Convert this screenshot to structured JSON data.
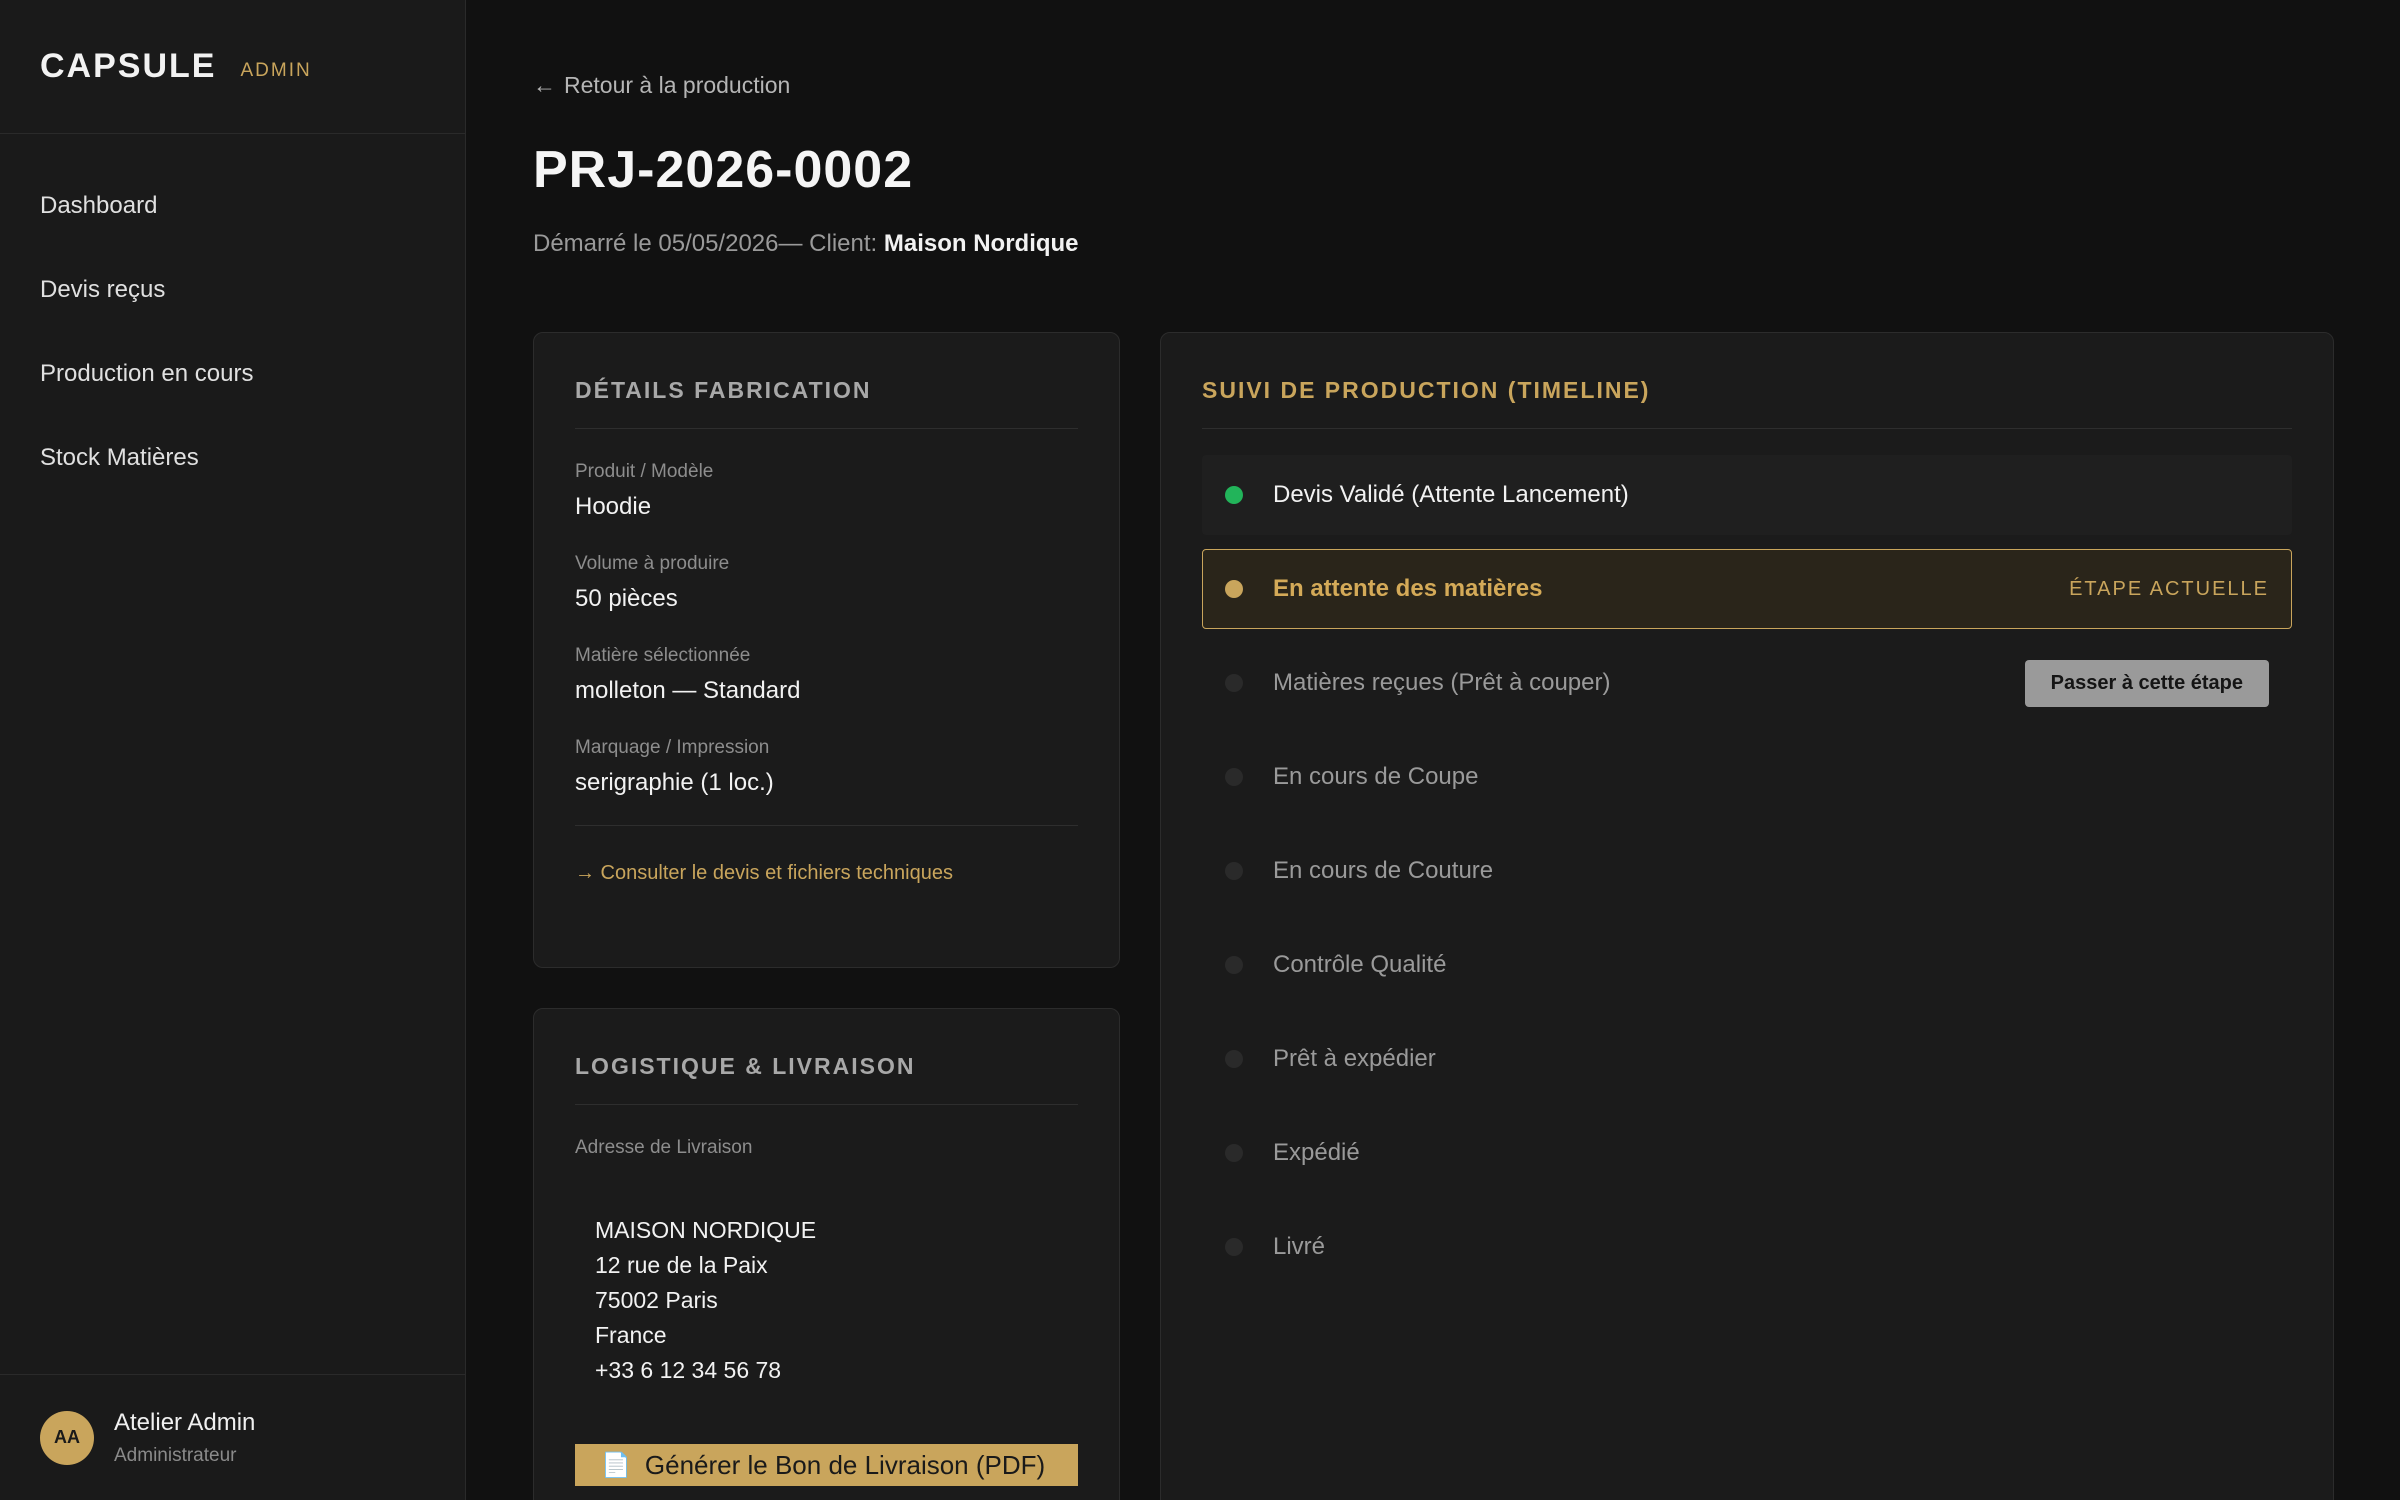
{
  "brand": {
    "name": "CAPSULE",
    "tag": "ADMIN"
  },
  "nav": [
    {
      "label": "Dashboard"
    },
    {
      "label": "Devis reçus"
    },
    {
      "label": "Production en cours"
    },
    {
      "label": "Stock Matières"
    }
  ],
  "user": {
    "initials": "AA",
    "name": "Atelier Admin",
    "role": "Administrateur"
  },
  "header": {
    "back_label": "Retour à la production",
    "title": "PRJ-2026-0002",
    "started": "Démarré le 05/05/2026— Client: ",
    "client": "Maison Nordique"
  },
  "details": {
    "title": "DÉTAILS FABRICATION",
    "fields": [
      {
        "label": "Produit / Modèle",
        "value": "Hoodie"
      },
      {
        "label": "Volume à produire",
        "value": "50 pièces"
      },
      {
        "label": "Matière sélectionnée",
        "value": "molleton — Standard"
      },
      {
        "label": "Marquage / Impression",
        "value": "serigraphie (1 loc.)"
      }
    ],
    "link": "→ Consulter le devis et fichiers techniques"
  },
  "logistics": {
    "title": "LOGISTIQUE & LIVRAISON",
    "address_label": "Adresse de Livraison",
    "address_lines": [
      "MAISON NORDIQUE",
      "12 rue de la Paix",
      "75002 Paris",
      "France",
      "+33 6 12 34 56 78"
    ],
    "pdf_button": "Générer le Bon de Livraison (PDF)"
  },
  "timeline": {
    "title": "SUIVI DE PRODUCTION (TIMELINE)",
    "current_tag": "ÉTAPE ACTUELLE",
    "advance_button": "Passer à cette étape",
    "steps": [
      {
        "label": "Devis Validé (Attente Lancement)",
        "status": "done"
      },
      {
        "label": "En attente des matières",
        "status": "current"
      },
      {
        "label": "Matières reçues (Prêt à couper)",
        "status": "next"
      },
      {
        "label": "En cours de Coupe",
        "status": "pending"
      },
      {
        "label": "En cours de Couture",
        "status": "pending"
      },
      {
        "label": "Contrôle Qualité",
        "status": "pending"
      },
      {
        "label": "Prêt à expédier",
        "status": "pending"
      },
      {
        "label": "Expédié",
        "status": "pending"
      },
      {
        "label": "Livré",
        "status": "pending"
      }
    ]
  },
  "colors": {
    "accent": "#c9a55c",
    "done": "#22b45a",
    "background": "#111111",
    "surface": "#1b1b1b"
  }
}
